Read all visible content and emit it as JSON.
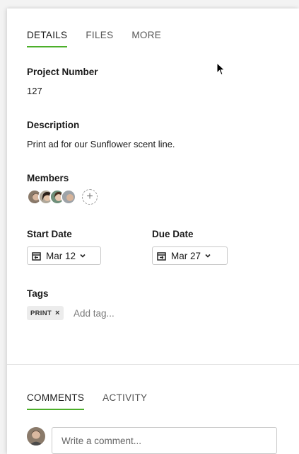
{
  "tabs": [
    {
      "label": "DETAILS",
      "active": true
    },
    {
      "label": "FILES",
      "active": false
    },
    {
      "label": "MORE",
      "active": false
    }
  ],
  "project_number": {
    "label": "Project Number",
    "value": "127"
  },
  "description": {
    "label": "Description",
    "value": "Print ad for our Sunflower scent line."
  },
  "members": {
    "label": "Members",
    "add_symbol": "+"
  },
  "start_date": {
    "label": "Start Date",
    "value": "Mar 12"
  },
  "due_date": {
    "label": "Due Date",
    "value": "Mar 27"
  },
  "tags": {
    "label": "Tags",
    "items": [
      {
        "label": "PRINT",
        "remove": "×"
      }
    ],
    "placeholder": "Add tag..."
  },
  "bottom_tabs": [
    {
      "label": "COMMENTS",
      "active": true
    },
    {
      "label": "ACTIVITY",
      "active": false
    }
  ],
  "comment": {
    "placeholder": "Write a comment..."
  },
  "colors": {
    "accent": "#4caf2a"
  }
}
